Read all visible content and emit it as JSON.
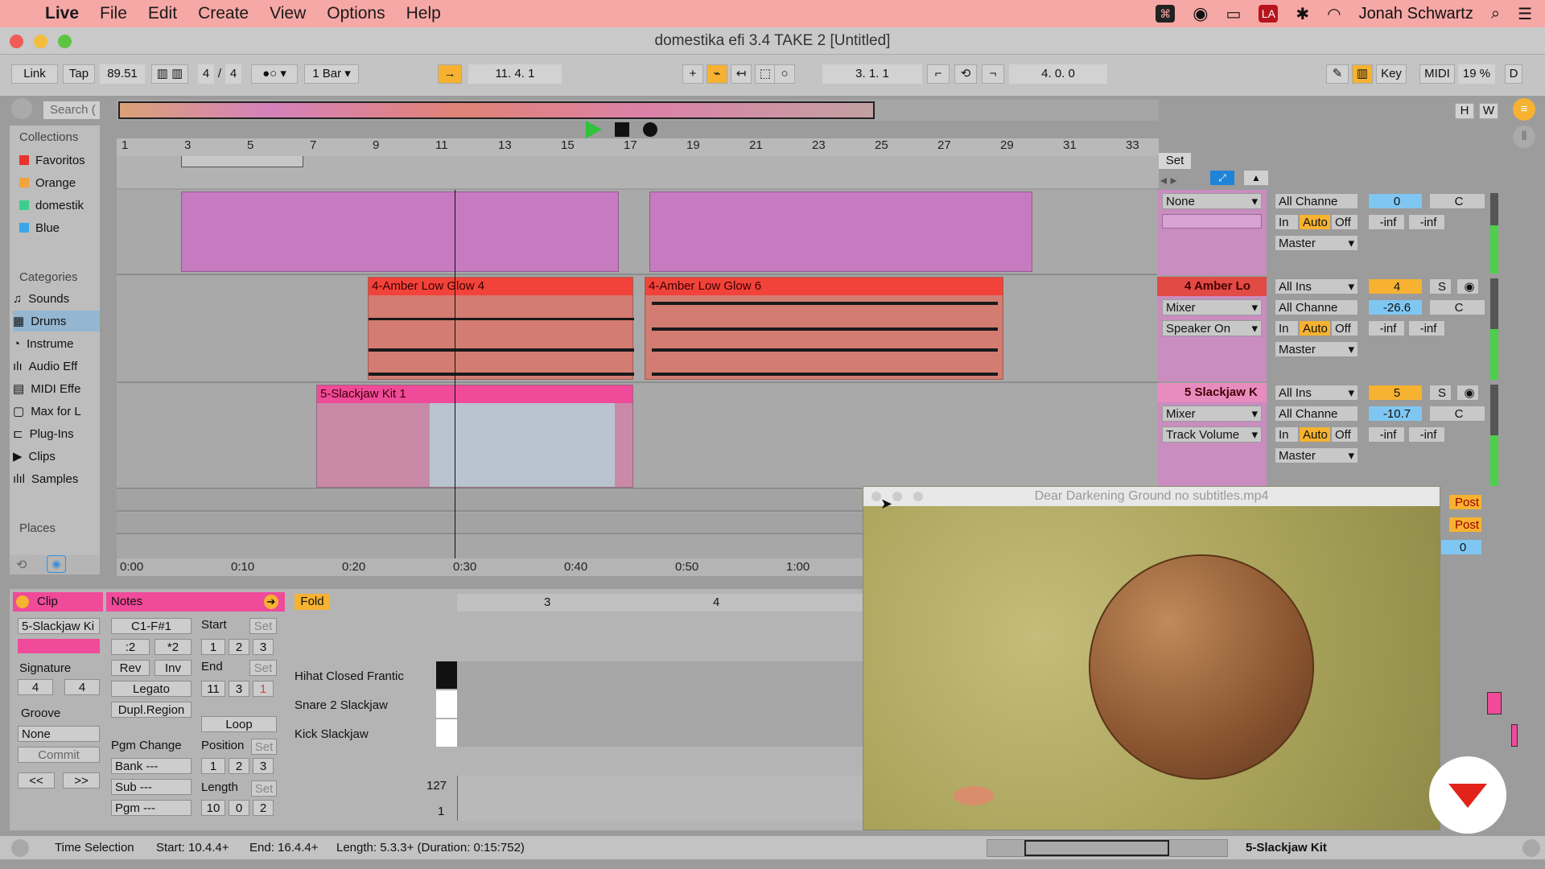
{
  "menubar": {
    "app": "Live",
    "items": [
      "File",
      "Edit",
      "Create",
      "View",
      "Options",
      "Help"
    ],
    "user": "Jonah Schwartz"
  },
  "window": {
    "title": "domestika efi 3.4 TAKE 2  [Untitled]"
  },
  "transport": {
    "link": "Link",
    "tap": "Tap",
    "tempo": "89.51",
    "sig_num": "4",
    "sig_den": "4",
    "quant": "1 Bar",
    "arr_pos": "11.   4.   1",
    "loop_start": "3.   1.   1",
    "loop_len": "4.   0.   0",
    "key": "Key",
    "midi": "MIDI",
    "cpu": "19 %",
    "d": "D"
  },
  "browser": {
    "search": "Search (",
    "collections_header": "Collections",
    "collections": [
      {
        "label": "Favoritos",
        "color": "#e8322a"
      },
      {
        "label": "Orange",
        "color": "#f2a33a"
      },
      {
        "label": "domestik",
        "color": "#3bcf8e"
      },
      {
        "label": "Blue",
        "color": "#3aa6e8"
      }
    ],
    "categories_header": "Categories",
    "categories": [
      "Sounds",
      "Drums",
      "Instrume",
      "Audio Eff",
      "MIDI Effe",
      "Max for L",
      "Plug-Ins",
      "Clips",
      "Samples"
    ],
    "places_header": "Places"
  },
  "ruler": {
    "bars": [
      "1",
      "3",
      "5",
      "7",
      "9",
      "11",
      "13",
      "15",
      "17",
      "19",
      "21",
      "23",
      "25",
      "27",
      "29",
      "31",
      "33"
    ],
    "set": "Set"
  },
  "timeline": {
    "times": [
      "0:00",
      "0:10",
      "0:20",
      "0:30",
      "0:40",
      "0:50",
      "1:00"
    ]
  },
  "clips": {
    "c4a": "4-Amber Low Glow 4",
    "c4b": "4-Amber Low Glow 6",
    "c5": "5-Slackjaw Kit 1"
  },
  "mixer": {
    "t3": {
      "input": "None",
      "channel": "All Channe",
      "in": "In",
      "auto": "Auto",
      "off": "Off",
      "out": "Master",
      "num": "0",
      "pan": "C",
      "send1": "-inf",
      "send2": "-inf"
    },
    "t4": {
      "name": "4 Amber Lo",
      "input": "All Ins",
      "channel": "All Channe",
      "mon1": "Mixer",
      "mon2": "Speaker On",
      "in": "In",
      "auto": "Auto",
      "off": "Off",
      "out": "Master",
      "num": "4",
      "solo": "S",
      "vol": "-26.6",
      "pan": "C",
      "send1": "-inf",
      "send2": "-inf"
    },
    "t5": {
      "name": "5 Slackjaw K",
      "input": "All Ins",
      "channel": "All Channe",
      "mon1": "Mixer",
      "mon2": "Track Volume",
      "in": "In",
      "auto": "Auto",
      "off": "Off",
      "out": "Master",
      "num": "5",
      "solo": "S",
      "vol": "-10.7",
      "pan": "C",
      "send1": "-inf",
      "send2": "-inf"
    },
    "post": "Post",
    "master_val": "0"
  },
  "clipview": {
    "clip_tab": "Clip",
    "clip_name": "5-Slackjaw Ki",
    "signature_label": "Signature",
    "sig_num": "4",
    "sig_den": "4",
    "groove_label": "Groove",
    "groove": "None",
    "commit": "Commit",
    "prev": "<<",
    "next": ">>",
    "notes_tab": "Notes",
    "range": "C1-F#1",
    "half": ":2",
    "dbl": "*2",
    "rev": "Rev",
    "inv": "Inv",
    "legato": "Legato",
    "dupl": "Dupl.Region",
    "pgm_change": "Pgm Change",
    "bank": "Bank ---",
    "sub": "Sub ---",
    "pgm": "Pgm ---",
    "start": "Start",
    "set": "Set",
    "start_v": [
      "1",
      "2",
      "3"
    ],
    "end": "End",
    "end_v": [
      "11",
      "3",
      "1"
    ],
    "loop": "Loop",
    "position": "Position",
    "pos_v": [
      "1",
      "2",
      "3"
    ],
    "length": "Length",
    "len_v": [
      "10",
      "0",
      "2"
    ],
    "fold": "Fold",
    "bars": [
      "3",
      "4"
    ],
    "keys": [
      "Hihat Closed Frantic",
      "Snare 2 Slackjaw",
      "Kick Slackjaw"
    ],
    "vel_max": "127",
    "vel_min": "1"
  },
  "video": {
    "title": "Dear Darkening Ground no subtitles.mp4"
  },
  "status": {
    "text": "Time Selection",
    "start": "Start: 10.4.4+",
    "end": "End: 16.4.4+",
    "length": "Length: 5.3.3+ (Duration: 0:15:752)",
    "track": "5-Slackjaw Kit"
  }
}
